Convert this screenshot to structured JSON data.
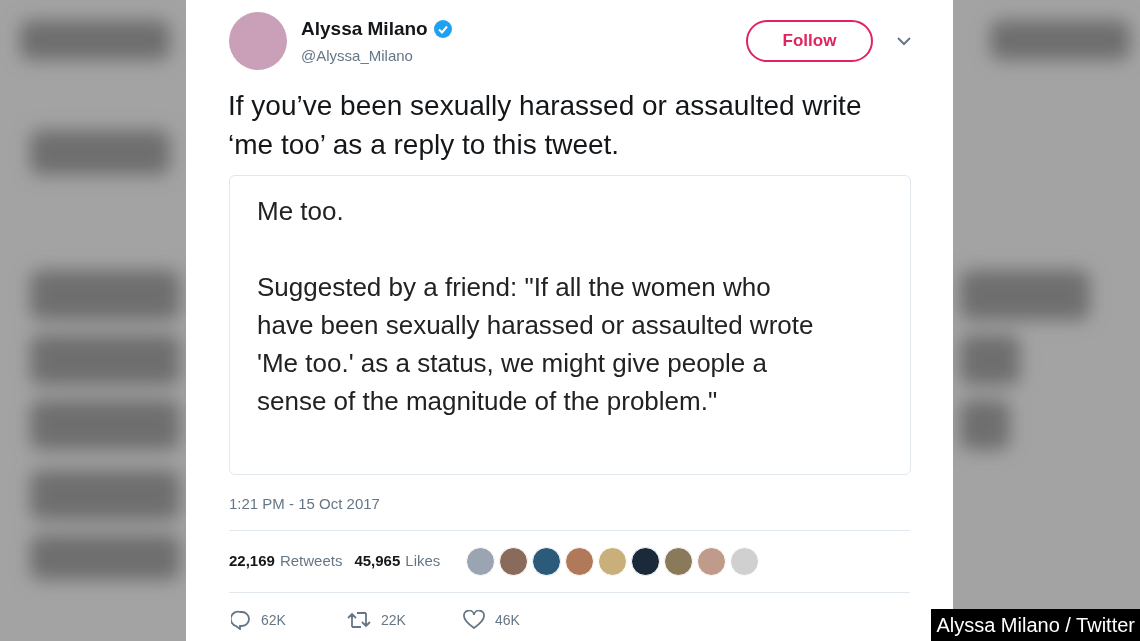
{
  "tweet": {
    "name": "Alyssa Milano",
    "verified": true,
    "handle": "@Alyssa_Milano",
    "follow_button": "Follow",
    "text": "If you’ve been sexually harassed or assaulted write ‘me too’ as a reply to this tweet.",
    "quoted_image": {
      "paragraphs": [
        "Me too.",
        "Suggested by a friend: \"If all the women who have been sexually harassed or assaulted wrote 'Me too.' as a status, we might give people a sense of the magnitude of the problem.\""
      ]
    },
    "timestamp": "1:21 PM - 15 Oct 2017",
    "stats": [
      {
        "count": "22,169",
        "label": "Retweets"
      },
      {
        "count": "45,965",
        "label": "Likes"
      }
    ],
    "actions": [
      {
        "kind": "reply",
        "count": "62K"
      },
      {
        "kind": "retweet",
        "count": "22K"
      },
      {
        "kind": "like",
        "count": "46K"
      }
    ]
  },
  "credit": "Alyssa Milano / Twitter"
}
